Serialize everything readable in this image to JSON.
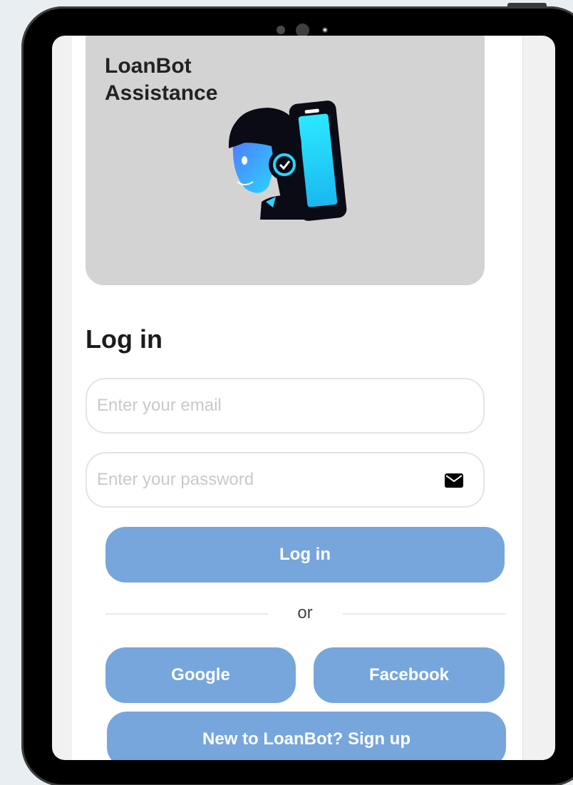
{
  "hero": {
    "title_line1": "LoanBot",
    "title_line2": "Assistance",
    "illustration_icon": "support-agent-headset-icon"
  },
  "login": {
    "heading": "Log in",
    "email_placeholder": "Enter your email",
    "email_value": "",
    "password_placeholder": "Enter your password",
    "password_value": "",
    "password_icon": "envelope-icon",
    "submit_label": "Log in",
    "divider_text": "or"
  },
  "social": {
    "google_label": "Google",
    "facebook_label": "Facebook"
  },
  "signup": {
    "label": "New to LoanBot? Sign up"
  },
  "colors": {
    "accent": "#76a6dc",
    "hero_bg": "#d3d3d3",
    "page_bg": "#e8eef2"
  }
}
